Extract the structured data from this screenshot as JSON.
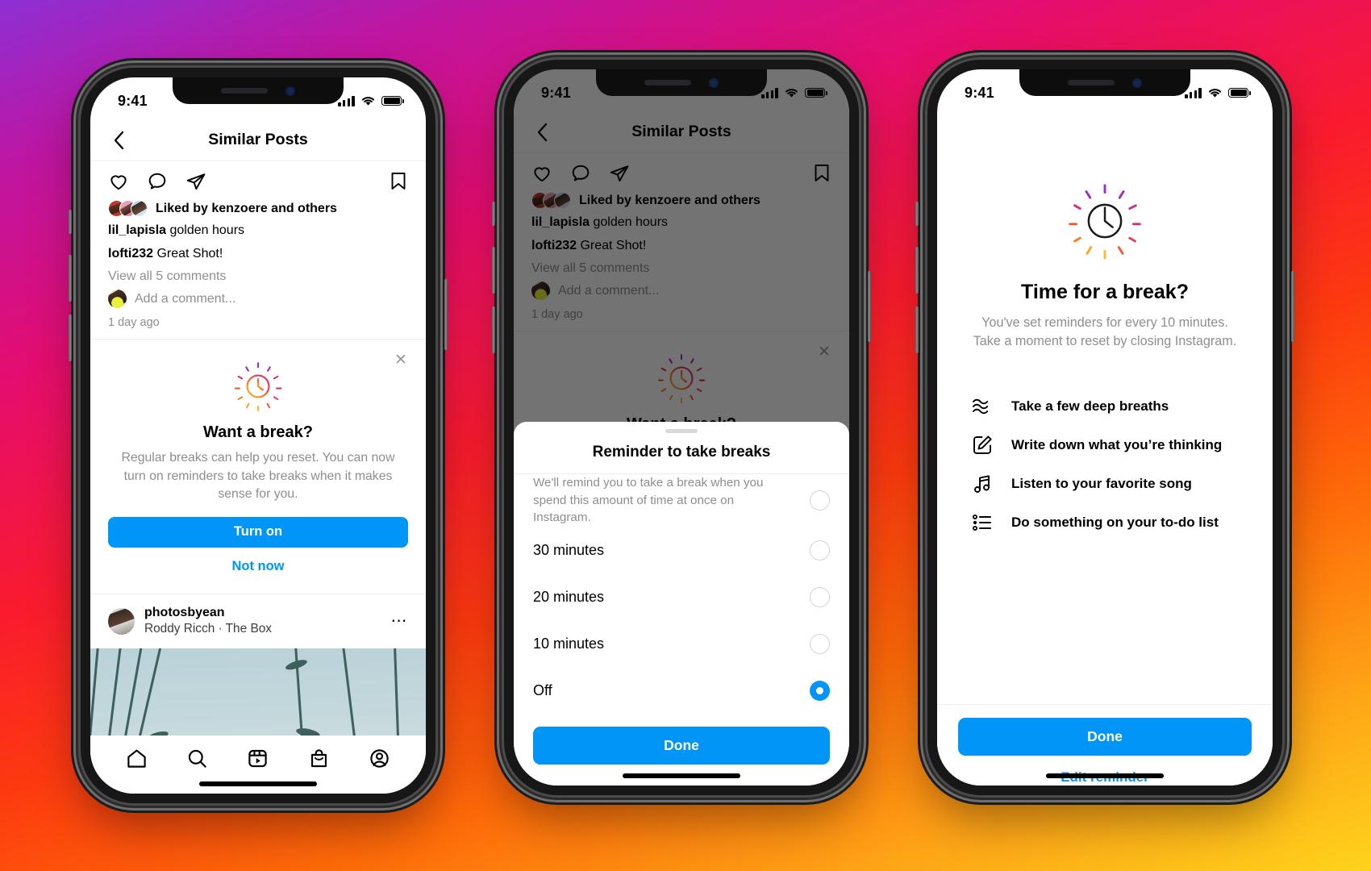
{
  "background": {
    "gradient_colors": [
      "#fed31c",
      "#fe6a09",
      "#fa1b2e",
      "#e50d6e",
      "#8e2fd4"
    ]
  },
  "accent": {
    "blue": "#0095f6",
    "grey_text": "#8e8e8e"
  },
  "status_bar": {
    "time": "9:41",
    "signal_icon": "cellular-bars-icon",
    "wifi_icon": "wifi-icon",
    "battery_icon": "battery-icon"
  },
  "phone1": {
    "header": {
      "back_icon": "chevron-left-icon",
      "title": "Similar Posts"
    },
    "post_actions": {
      "like_icon": "heart-icon",
      "comment_icon": "comment-bubble-icon",
      "share_icon": "paper-plane-icon",
      "save_icon": "bookmark-icon"
    },
    "liked_by": "Liked by kenzoere and others",
    "caption_user": "lil_lapisla",
    "caption_text": "golden hours",
    "comment_user": "lofti232",
    "comment_text": "Great Shot!",
    "view_all": "View all 5 comments",
    "add_comment_placeholder": "Add a comment...",
    "timestamp": "1 day ago",
    "break_card": {
      "close_icon": "close-x-icon",
      "clock_icon": "sun-clock-icon",
      "title": "Want a break?",
      "subtitle": "Regular breaks can help you reset. You can now turn on reminders to take breaks when it makes sense for you.",
      "primary_button": "Turn on",
      "secondary_link": "Not now"
    },
    "next_post": {
      "username": "photosbyean",
      "audio": "Roddy Ricch · The Box",
      "more_icon": "more-dots-icon"
    },
    "nav": [
      {
        "name": "home-icon",
        "label": "Home"
      },
      {
        "name": "search-icon",
        "label": "Search"
      },
      {
        "name": "reels-icon",
        "label": "Reels"
      },
      {
        "name": "shop-icon",
        "label": "Shop"
      },
      {
        "name": "profile-icon",
        "label": "Profile"
      }
    ]
  },
  "phone2": {
    "header": {
      "back_icon": "chevron-left-icon",
      "title": "Similar Posts"
    },
    "liked_by": "Liked by kenzoere and others",
    "caption_user": "lil_lapisla",
    "caption_text": "golden hours",
    "comment_user": "lofti232",
    "comment_text": "Great Shot!",
    "view_all": "View all 5 comments",
    "add_comment_placeholder": "Add a comment...",
    "timestamp": "1 day ago",
    "break_card_title": "Want a break?",
    "sheet": {
      "grabber": "drag-handle",
      "title": "Reminder to take breaks",
      "description": "We'll remind you to take a break when you spend this amount of time at once on Instagram.",
      "options": [
        {
          "label": "30 minutes",
          "selected": false
        },
        {
          "label": "20 minutes",
          "selected": false
        },
        {
          "label": "10 minutes",
          "selected": false
        },
        {
          "label": "Off",
          "selected": true
        }
      ],
      "done_button": "Done"
    }
  },
  "phone3": {
    "clock_icon": "sun-clock-icon",
    "title": "Time for a break?",
    "subtitle_line1": "You've set reminders for every 10 minutes.",
    "subtitle_line2": "Take a moment to reset by closing Instagram.",
    "suggestions": [
      {
        "icon": "waves-icon",
        "label": "Take a few deep breaths"
      },
      {
        "icon": "pencil-square-icon",
        "label": "Write down what you’re thinking"
      },
      {
        "icon": "music-note-icon",
        "label": "Listen to your favorite song"
      },
      {
        "icon": "checklist-icon",
        "label": "Do something on your to-do list"
      }
    ],
    "done_button": "Done",
    "edit_link": "Edit reminder"
  }
}
